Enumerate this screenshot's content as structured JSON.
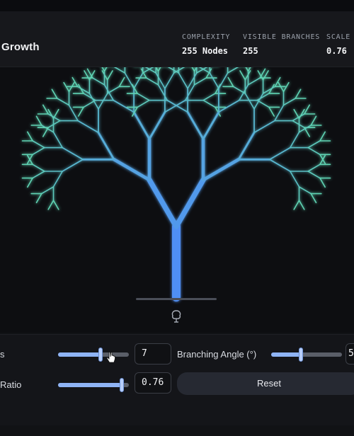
{
  "header": {
    "title": "Growth",
    "stats": [
      {
        "label": "COMPLEXITY",
        "value": "255 Nodes"
      },
      {
        "label": "VISIBLE BRANCHES",
        "value": "255"
      },
      {
        "label": "SCALE",
        "value": "0.76"
      }
    ]
  },
  "canvas": {
    "tree_depth": 7,
    "branch_angle_deg": 30,
    "scale_ratio": 0.76,
    "trunk_color": "#4f8ff5",
    "tip_color": "#5fd3b3",
    "icon": "tree-icon"
  },
  "controls": {
    "depth": {
      "label": "s",
      "value": "7",
      "fraction": 0.6
    },
    "angle": {
      "label": "Branching Angle (°)",
      "value": "5",
      "fraction": 0.42
    },
    "ratio": {
      "label": "Ratio",
      "value": "0.76",
      "fraction": 0.9
    },
    "reset_label": "Reset"
  },
  "colors": {
    "accent": "#8fb4f5",
    "background": "#0d0e11"
  }
}
